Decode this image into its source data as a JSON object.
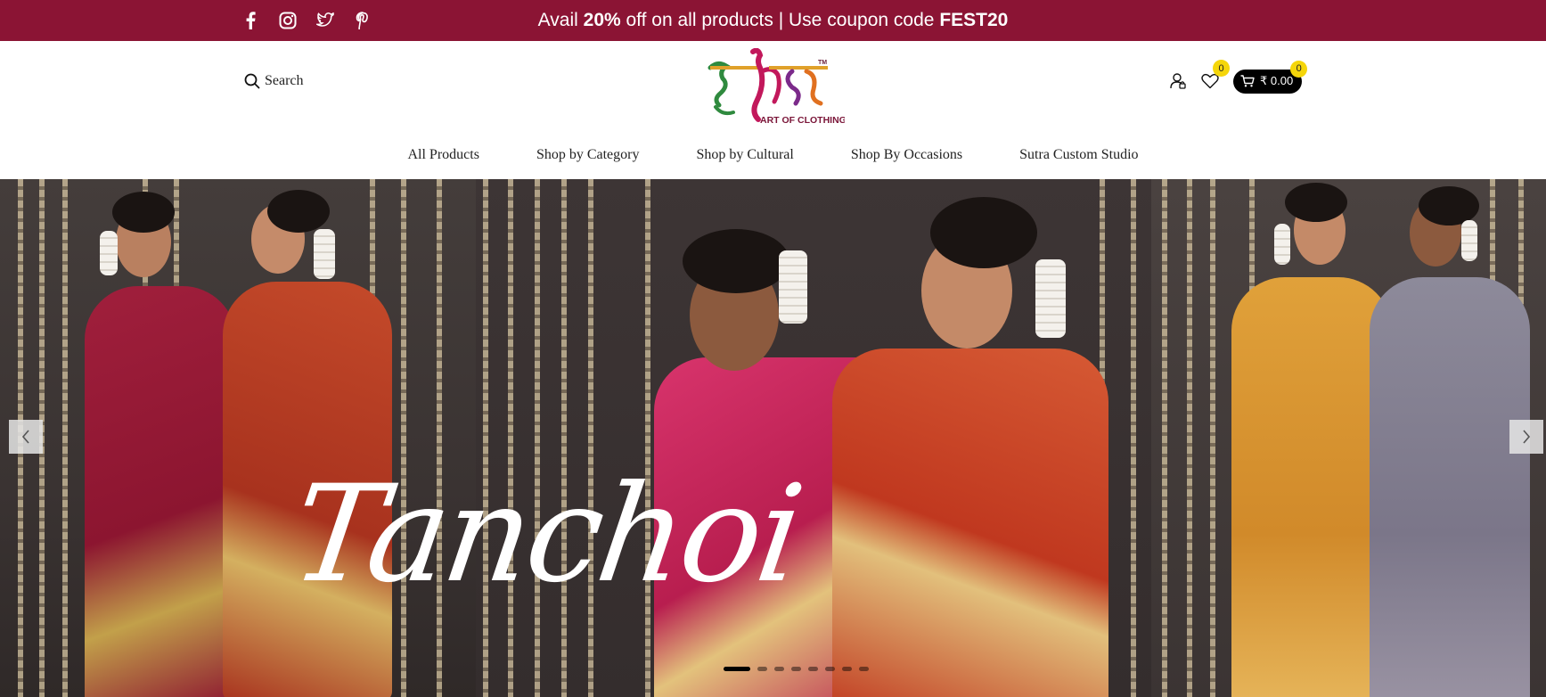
{
  "promo": {
    "prefix": "Avail ",
    "discount": "20%",
    "middle": " off on all products | Use coupon code ",
    "code": "FEST20"
  },
  "social": [
    "facebook-icon",
    "instagram-icon",
    "twitter-icon",
    "pinterest-icon"
  ],
  "header": {
    "search_label": "Search",
    "logo_mark": "सूत्र",
    "logo_tm": "TM",
    "logo_tagline": "ART OF CLOTHING",
    "wishlist_count": "0",
    "cart_count": "0",
    "cart_total": "₹ 0.00"
  },
  "nav": {
    "items": [
      {
        "label": "All Products"
      },
      {
        "label": "Shop by Category"
      },
      {
        "label": "Shop by Cultural"
      },
      {
        "label": "Shop By Occasions"
      },
      {
        "label": "Sutra Custom Studio"
      }
    ]
  },
  "hero": {
    "title": "Tanchoi",
    "slide_count": 8,
    "active_slide": 1
  },
  "colors": {
    "brand": "#8b1434",
    "accent_badge": "#f5d60a",
    "cart_bg": "#000000"
  }
}
